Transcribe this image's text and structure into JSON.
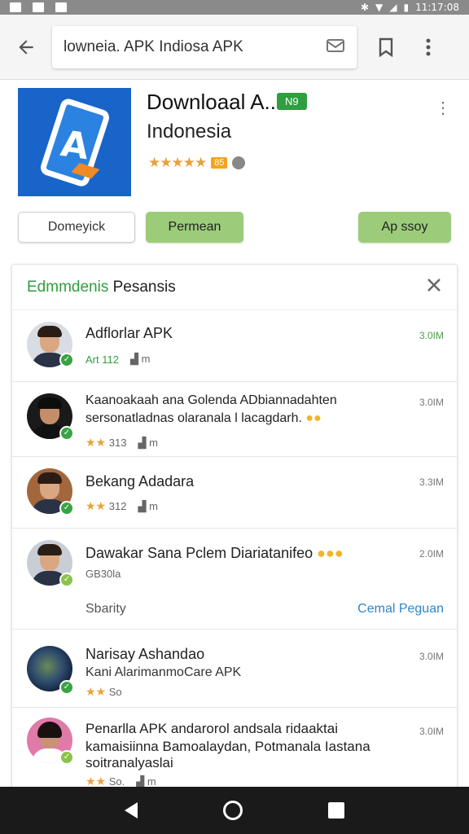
{
  "status_bar": {
    "time": "11:17:08"
  },
  "search": {
    "value": "lowneia. APK Indiosa APK"
  },
  "app": {
    "title": "Downloaal A...",
    "badge": "N9",
    "subtitle": "Indonesia",
    "stars": "★★★★★",
    "pill": "85"
  },
  "buttons": {
    "outline": "Domeyick",
    "green": "Permean",
    "green2": "Ap ssoy"
  },
  "card": {
    "title_green": "Edmmdenis",
    "title_rest": " Pesansis",
    "rows": [
      {
        "title": "Adflorlar APK",
        "meta": "Art 112",
        "dl": "m",
        "size": "3.0IM"
      },
      {
        "title": "Kaanoakaah ana Golenda ADbiannadahten",
        "title2": "sersonatladnas olaranala l lacagdarh.",
        "stars": "★★",
        "meta": "313",
        "dl": "m",
        "size": "3.0IM"
      },
      {
        "title": "Bekang Adadara",
        "stars": "★★",
        "meta": "312",
        "dl": "m",
        "size": "3.3IM"
      },
      {
        "title": "Dawakar Sana Pclem Diariatanifeo",
        "meta": "GB30la",
        "size": "2.0IM",
        "footer_left": "Sbarity",
        "footer_right": "Cemal Peguan"
      },
      {
        "title": "Narisay Ashandao",
        "subtitle": "Kani AlarimanmoCare APK",
        "stars": "★★",
        "meta": "So",
        "size": "3.0IM"
      },
      {
        "title": "Penarlla APK andarorol andsala ridaaktai",
        "title2": "kamaisiinna Bamoalaydan, Potmanala Iastana",
        "title3": "soitranalyaslai",
        "stars": "★★",
        "meta": "So.",
        "dl": "m",
        "size": "3.0IM"
      }
    ]
  },
  "colors": {
    "accent_green": "#2e9e3f",
    "button_green": "#9ccc7a",
    "app_icon_blue": "#1864c9",
    "link_blue": "#2e86c8"
  },
  "icons": [
    "back-arrow-icon",
    "mail-icon",
    "bookmark-icon",
    "overflow-menu-icon",
    "close-icon",
    "verified-check-icon",
    "download-icon",
    "nav-back-icon",
    "nav-home-icon",
    "nav-recents-icon"
  ]
}
